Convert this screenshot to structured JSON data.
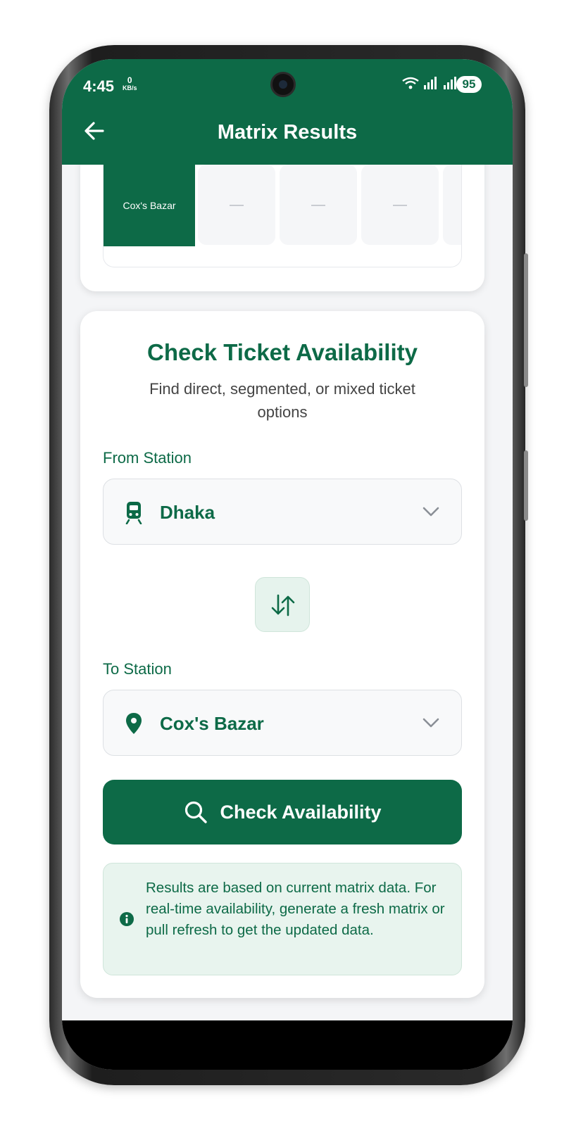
{
  "status_bar": {
    "time": "4:45",
    "net_speed_value": "0",
    "net_speed_unit": "KB/s",
    "battery": "95",
    "icons": [
      "wifi-icon",
      "signal-icon",
      "signal-icon"
    ]
  },
  "header": {
    "title": "Matrix Results",
    "back_icon": "arrow-left-icon"
  },
  "matrix": {
    "station_label": "Cox's Bazar",
    "cells": [
      "—",
      "—",
      "—"
    ]
  },
  "availability": {
    "title": "Check Ticket Availability",
    "subtitle": "Find direct, segmented, or mixed ticket options",
    "from_label": "From Station",
    "from_value": "Dhaka",
    "from_icon": "train-icon",
    "swap_icon": "swap-vertical-icon",
    "to_label": "To Station",
    "to_value": "Cox's Bazar",
    "to_icon": "location-pin-icon",
    "button_label": "Check Availability",
    "button_icon": "search-icon",
    "info_text": "Results are based on current matrix data. For real-time availability, generate a fresh matrix or pull refresh to get the updated data.",
    "info_icon": "info-icon"
  },
  "colors": {
    "primary": "#0d6a47",
    "light_green": "#e8f4ee"
  }
}
